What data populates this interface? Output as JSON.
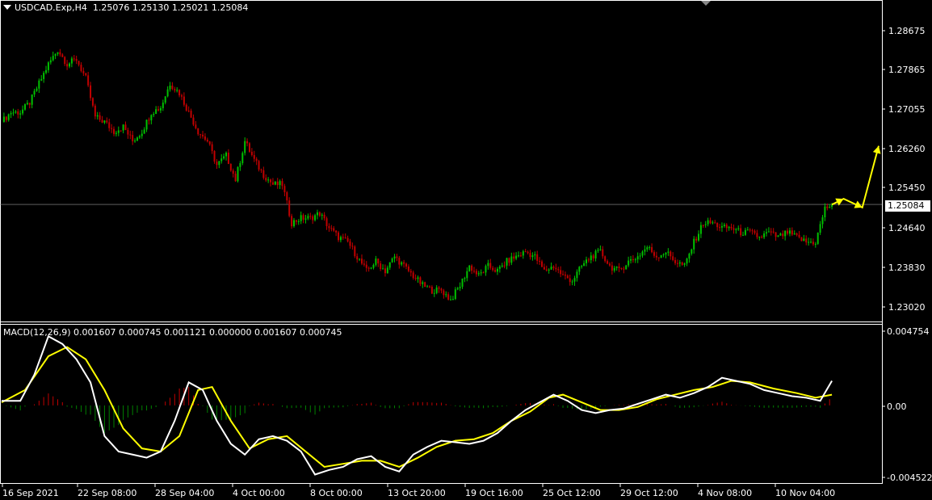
{
  "header": {
    "symbol_tf": "USDCAD.Exp,H4",
    "ohlc": "1.25076 1.25130 1.25021 1.25084"
  },
  "macd_header": {
    "label": "MACD(12,26,9) 0.001607 0.000745 0.001121 0.000000 0.001607 0.000745"
  },
  "current_price": "1.25084",
  "colors": {
    "background": "#000000",
    "grid": "#ffffff",
    "bull": "#00c000",
    "bear": "#c00000",
    "macd_line": "#ffffff",
    "signal_line": "#ffff00",
    "arrow": "#ffff00"
  },
  "chart_data": [
    {
      "type": "candlestick",
      "title": "USDCAD.Exp,H4",
      "ylim": [
        1.227,
        1.292
      ],
      "y_ticks": [
        "1.28675",
        "1.27865",
        "1.27055",
        "1.26260",
        "1.25450",
        "1.24640",
        "1.23830",
        "1.23020"
      ],
      "x_ticks": [
        "16 Sep 2021",
        "22 Sep 08:00",
        "28 Sep 04:00",
        "4 Oct 00:00",
        "8 Oct 00:00",
        "13 Oct 20:00",
        "19 Oct 16:00",
        "25 Oct 12:00",
        "29 Oct 12:00",
        "4 Nov 08:00",
        "10 Nov 04:00"
      ],
      "close_path": [
        [
          0,
          1.268
        ],
        [
          4,
          1.27
        ],
        [
          8,
          1.27
        ],
        [
          12,
          1.272
        ],
        [
          16,
          1.276
        ],
        [
          20,
          1.28
        ],
        [
          24,
          1.283
        ],
        [
          28,
          1.28
        ],
        [
          32,
          1.281
        ],
        [
          36,
          1.277
        ],
        [
          40,
          1.269
        ],
        [
          44,
          1.268
        ],
        [
          48,
          1.266
        ],
        [
          52,
          1.267
        ],
        [
          56,
          1.264
        ],
        [
          60,
          1.266
        ],
        [
          64,
          1.27
        ],
        [
          68,
          1.271
        ],
        [
          72,
          1.276
        ],
        [
          76,
          1.274
        ],
        [
          80,
          1.27
        ],
        [
          84,
          1.266
        ],
        [
          88,
          1.264
        ],
        [
          92,
          1.259
        ],
        [
          96,
          1.261
        ],
        [
          100,
          1.256
        ],
        [
          104,
          1.264
        ],
        [
          108,
          1.26
        ],
        [
          112,
          1.257
        ],
        [
          116,
          1.255
        ],
        [
          120,
          1.255
        ],
        [
          124,
          1.247
        ],
        [
          128,
          1.248
        ],
        [
          132,
          1.248
        ],
        [
          136,
          1.249
        ],
        [
          140,
          1.246
        ],
        [
          144,
          1.244
        ],
        [
          148,
          1.243
        ],
        [
          152,
          1.24
        ],
        [
          156,
          1.237
        ],
        [
          160,
          1.239
        ],
        [
          164,
          1.237
        ],
        [
          168,
          1.24
        ],
        [
          172,
          1.238
        ],
        [
          176,
          1.236
        ],
        [
          180,
          1.234
        ],
        [
          184,
          1.233
        ],
        [
          188,
          1.233
        ],
        [
          192,
          1.231
        ],
        [
          196,
          1.234
        ],
        [
          200,
          1.238
        ],
        [
          204,
          1.236
        ],
        [
          208,
          1.238
        ],
        [
          212,
          1.237
        ],
        [
          216,
          1.239
        ],
        [
          220,
          1.24
        ],
        [
          224,
          1.241
        ],
        [
          228,
          1.24
        ],
        [
          232,
          1.237
        ],
        [
          236,
          1.238
        ],
        [
          240,
          1.236
        ],
        [
          244,
          1.235
        ],
        [
          248,
          1.238
        ],
        [
          252,
          1.24
        ],
        [
          256,
          1.241
        ],
        [
          260,
          1.238
        ],
        [
          264,
          1.237
        ],
        [
          268,
          1.239
        ],
        [
          272,
          1.24
        ],
        [
          276,
          1.242
        ],
        [
          280,
          1.24
        ],
        [
          284,
          1.241
        ],
        [
          288,
          1.239
        ],
        [
          292,
          1.238
        ],
        [
          296,
          1.243
        ],
        [
          300,
          1.247
        ],
        [
          304,
          1.247
        ],
        [
          308,
          1.246
        ],
        [
          312,
          1.246
        ],
        [
          316,
          1.245
        ],
        [
          320,
          1.245
        ],
        [
          324,
          1.244
        ],
        [
          328,
          1.245
        ],
        [
          332,
          1.244
        ],
        [
          336,
          1.245
        ],
        [
          340,
          1.244
        ],
        [
          344,
          1.243
        ],
        [
          348,
          1.243
        ],
        [
          352,
          1.25
        ],
        [
          355,
          1.2508
        ]
      ],
      "current_price": 1.25084,
      "forecast_arrow": [
        [
          355,
          1.2508
        ],
        [
          360,
          1.252
        ],
        [
          368,
          1.2502
        ],
        [
          375,
          1.263
        ]
      ]
    },
    {
      "type": "macd",
      "title": "MACD(12,26,9)",
      "ylim": [
        -0.005,
        0.0052
      ],
      "y_ticks": [
        "0.004754",
        "0.00",
        "-0.004522"
      ],
      "macd_line": [
        [
          0,
          0.0003
        ],
        [
          8,
          0.0003
        ],
        [
          14,
          0.002
        ],
        [
          20,
          0.0045
        ],
        [
          26,
          0.004
        ],
        [
          32,
          0.003
        ],
        [
          38,
          0.0015
        ],
        [
          44,
          -0.002
        ],
        [
          50,
          -0.003
        ],
        [
          56,
          -0.0032
        ],
        [
          62,
          -0.0034
        ],
        [
          68,
          -0.003
        ],
        [
          74,
          -0.001
        ],
        [
          80,
          0.0015
        ],
        [
          86,
          0.001
        ],
        [
          92,
          -0.001
        ],
        [
          98,
          -0.0025
        ],
        [
          104,
          -0.0032
        ],
        [
          110,
          -0.0022
        ],
        [
          116,
          -0.002
        ],
        [
          122,
          -0.0023
        ],
        [
          128,
          -0.003
        ],
        [
          134,
          -0.0045
        ],
        [
          140,
          -0.0042
        ],
        [
          146,
          -0.004
        ],
        [
          152,
          -0.0035
        ],
        [
          158,
          -0.0033
        ],
        [
          164,
          -0.004
        ],
        [
          170,
          -0.0043
        ],
        [
          176,
          -0.0032
        ],
        [
          182,
          -0.0027
        ],
        [
          188,
          -0.0023
        ],
        [
          194,
          -0.0024
        ],
        [
          200,
          -0.0025
        ],
        [
          206,
          -0.0023
        ],
        [
          212,
          -0.0018
        ],
        [
          218,
          -0.001
        ],
        [
          224,
          -0.0003
        ],
        [
          230,
          0.0002
        ],
        [
          236,
          0.0007
        ],
        [
          242,
          0.0003
        ],
        [
          248,
          -0.0003
        ],
        [
          254,
          -0.0005
        ],
        [
          260,
          -0.0003
        ],
        [
          266,
          -0.0002
        ],
        [
          272,
          0.0001
        ],
        [
          278,
          0.0004
        ],
        [
          284,
          0.0007
        ],
        [
          290,
          0.0005
        ],
        [
          296,
          0.0008
        ],
        [
          302,
          0.0012
        ],
        [
          308,
          0.0018
        ],
        [
          314,
          0.0016
        ],
        [
          320,
          0.0014
        ],
        [
          326,
          0.001
        ],
        [
          332,
          0.0008
        ],
        [
          338,
          0.0006
        ],
        [
          344,
          0.0005
        ],
        [
          350,
          0.0003
        ],
        [
          355,
          0.0016
        ]
      ],
      "signal_line": [
        [
          0,
          0.0002
        ],
        [
          10,
          0.001
        ],
        [
          20,
          0.0032
        ],
        [
          28,
          0.0038
        ],
        [
          36,
          0.003
        ],
        [
          44,
          0.001
        ],
        [
          52,
          -0.0015
        ],
        [
          60,
          -0.0028
        ],
        [
          68,
          -0.003
        ],
        [
          76,
          -0.002
        ],
        [
          84,
          0.001
        ],
        [
          90,
          0.0012
        ],
        [
          98,
          -0.001
        ],
        [
          106,
          -0.0028
        ],
        [
          114,
          -0.0022
        ],
        [
          122,
          -0.002
        ],
        [
          130,
          -0.003
        ],
        [
          138,
          -0.004
        ],
        [
          146,
          -0.0038
        ],
        [
          154,
          -0.0036
        ],
        [
          162,
          -0.0036
        ],
        [
          170,
          -0.004
        ],
        [
          178,
          -0.0034
        ],
        [
          186,
          -0.0027
        ],
        [
          194,
          -0.0023
        ],
        [
          202,
          -0.0022
        ],
        [
          210,
          -0.0018
        ],
        [
          218,
          -0.001
        ],
        [
          226,
          -0.0004
        ],
        [
          234,
          0.0005
        ],
        [
          240,
          0.0007
        ],
        [
          248,
          0.0002
        ],
        [
          256,
          -0.0003
        ],
        [
          264,
          -0.0003
        ],
        [
          272,
          -0.0001
        ],
        [
          280,
          0.0004
        ],
        [
          288,
          0.0007
        ],
        [
          296,
          0.001
        ],
        [
          304,
          0.0012
        ],
        [
          312,
          0.0016
        ],
        [
          320,
          0.0015
        ],
        [
          330,
          0.0011
        ],
        [
          340,
          0.0008
        ],
        [
          348,
          0.0005
        ],
        [
          355,
          0.0007
        ]
      ]
    }
  ]
}
